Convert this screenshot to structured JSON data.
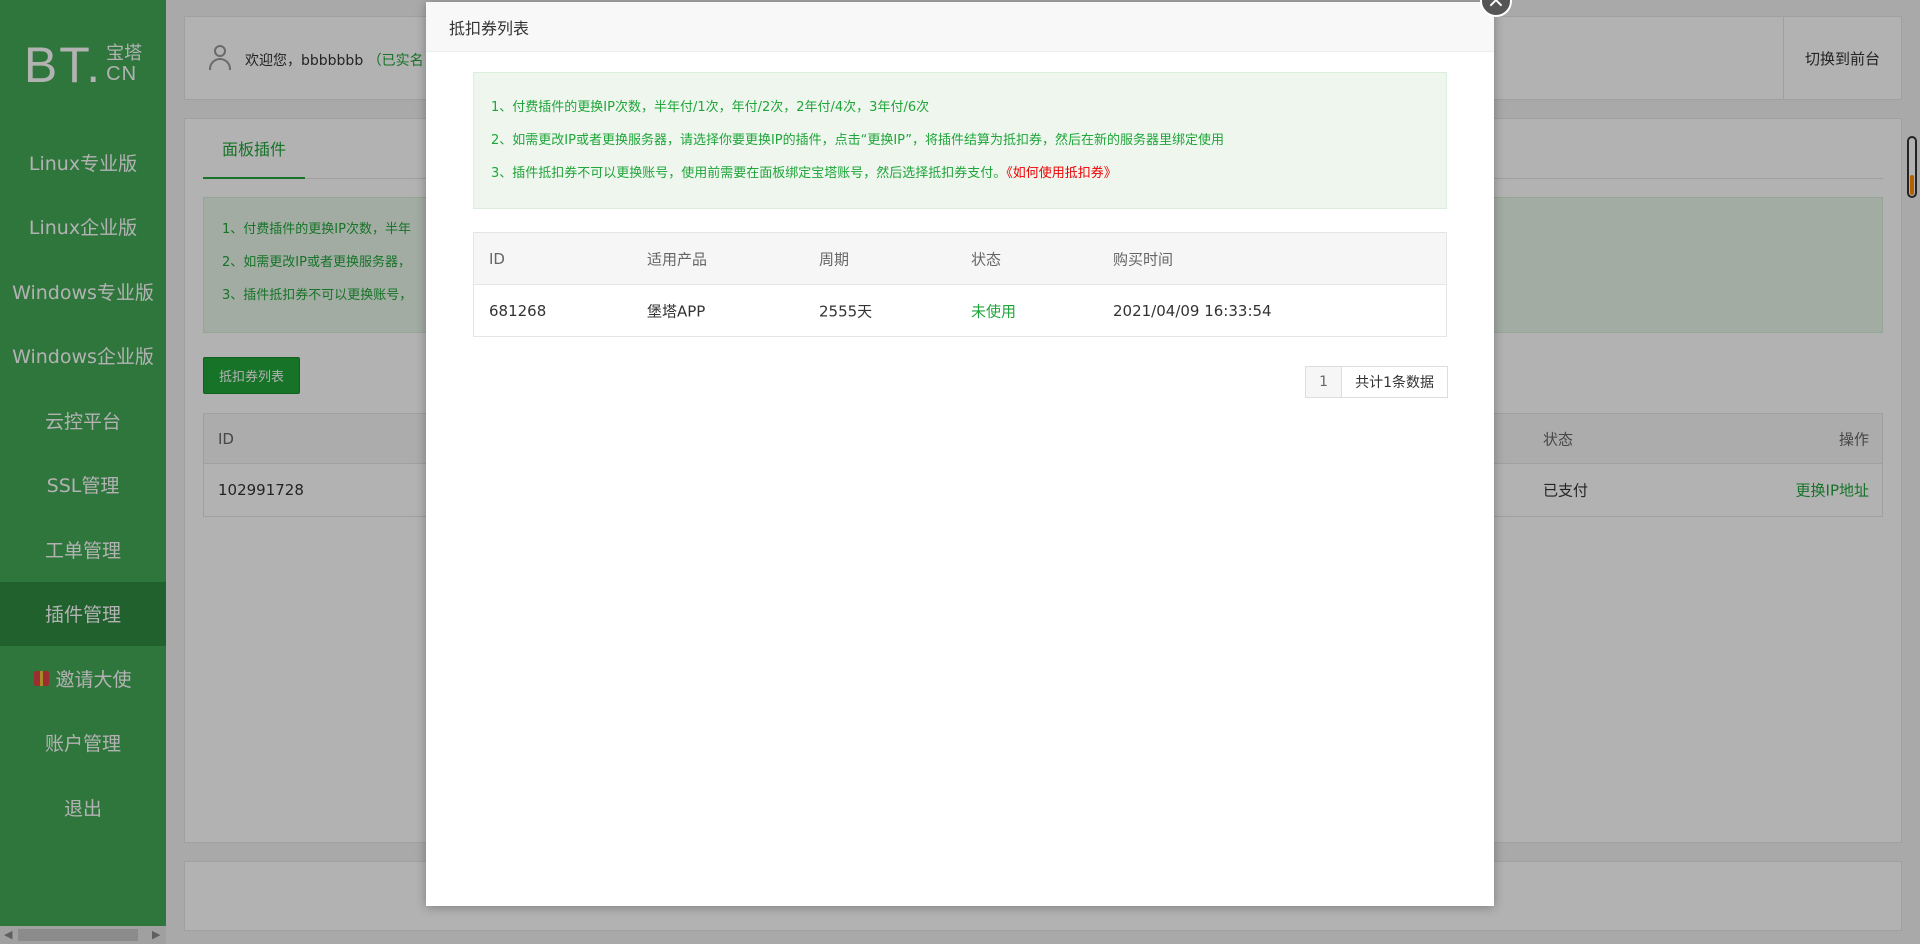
{
  "logo": {
    "bt": "BT.",
    "cn_top": "宝塔",
    "cn_bottom": "CN"
  },
  "sidebar": {
    "items": [
      {
        "label": "Linux专业版"
      },
      {
        "label": "Linux企业版"
      },
      {
        "label": "Windows专业版"
      },
      {
        "label": "Windows企业版"
      },
      {
        "label": "云控平台"
      },
      {
        "label": "SSL管理"
      },
      {
        "label": "工单管理"
      },
      {
        "label": "插件管理",
        "active": true
      },
      {
        "label": "邀请大使",
        "icon": "gift-icon"
      },
      {
        "label": "账户管理"
      },
      {
        "label": "退出"
      }
    ]
  },
  "topbar": {
    "welcome": "欢迎您，bbbbbbb",
    "realname_status": "（已实名",
    "switch_front": "切换到前台"
  },
  "main": {
    "tab_label": "面板插件",
    "notices": [
      "1、付费插件的更换IP次数，半年",
      "2、如需更改IP或者更换服务器，",
      "3、插件抵扣券不可以更换账号，"
    ],
    "voucher_button": "抵扣券列表",
    "table": {
      "headers": {
        "id": "ID",
        "status": "状态",
        "action": "操作"
      },
      "rows": [
        {
          "id": "102991728",
          "status": "已支付",
          "action": "更换IP地址"
        }
      ]
    }
  },
  "modal": {
    "title": "抵扣券列表",
    "close": "×",
    "notices": [
      "1、付费插件的更换IP次数，半年付/1次，年付/2次，2年付/4次，3年付/6次",
      "2、如需更改IP或者更换服务器，请选择你要更换IP的插件，点击“更换IP”，将插件结算为抵扣券，然后在新的服务器里绑定使用",
      "3、插件抵扣券不可以更换账号，使用前需要在面板绑定宝塔账号，然后选择抵扣券支付。"
    ],
    "notice_link": "《如何使用抵扣券》",
    "table": {
      "headers": [
        "ID",
        "适用产品",
        "周期",
        "状态",
        "购买时间"
      ],
      "rows": [
        [
          "681268",
          "堡塔APP",
          "2555天",
          "未使用",
          "2021/04/09 16:33:54"
        ]
      ]
    },
    "pager": {
      "current_page": "1",
      "total_text": "共计1条数据"
    }
  },
  "colors": {
    "sidebar_bg": "#43a957",
    "brand_green": "#20a53a",
    "link_red": "#e00000"
  }
}
